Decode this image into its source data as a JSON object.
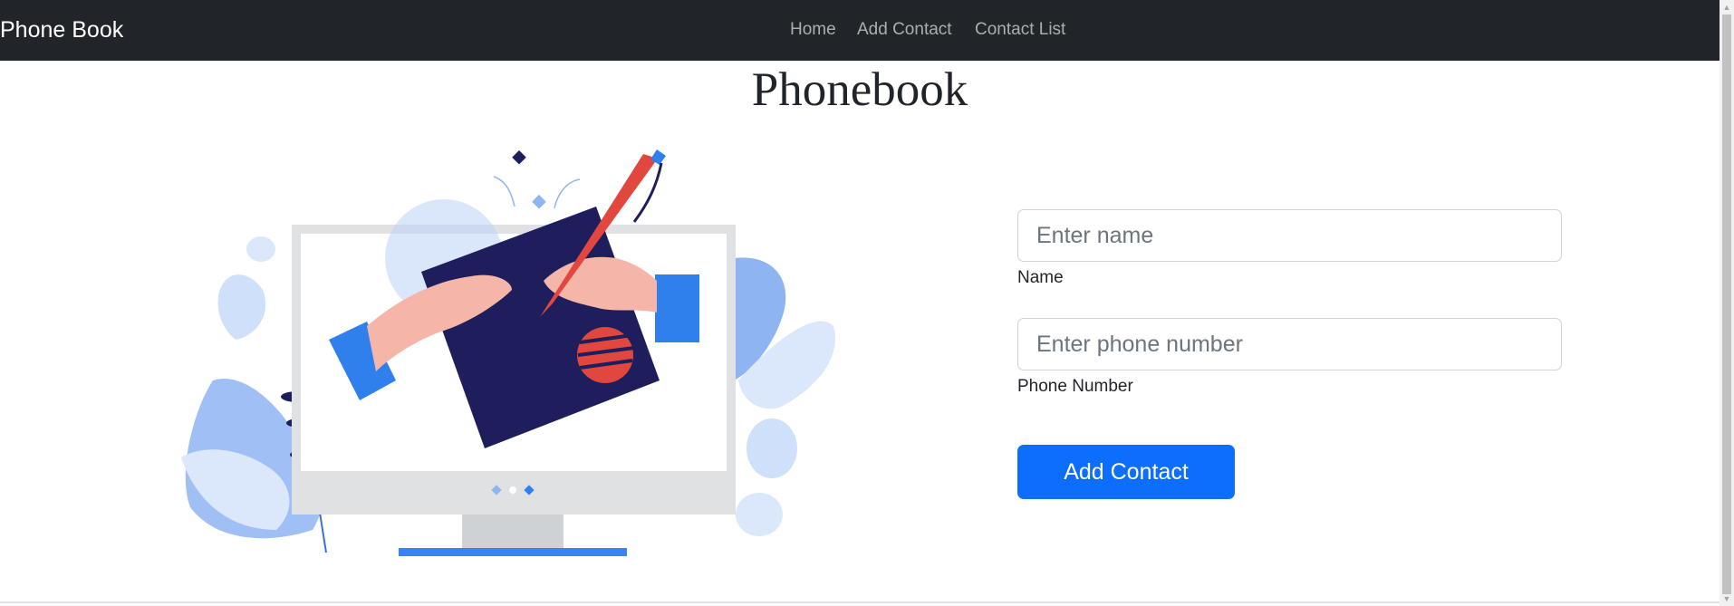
{
  "navbar": {
    "brand": "Phone Book",
    "links": [
      {
        "label": "Home"
      },
      {
        "label": "Add Contact"
      },
      {
        "label": "Contact List"
      }
    ]
  },
  "page": {
    "title": "Phonebook"
  },
  "form": {
    "name": {
      "placeholder": "Enter name",
      "value": "",
      "label": "Name"
    },
    "phone": {
      "placeholder": "Enter phone number",
      "value": "",
      "label": "Phone Number"
    },
    "submit_label": "Add Contact"
  },
  "colors": {
    "navbar_bg": "#212529",
    "primary": "#0d6efd",
    "illustration_navy": "#1e1e5c",
    "illustration_red": "#e2473f",
    "illustration_blue": "#2f80ed"
  },
  "icons": {
    "illustration": "computer-monitor-with-hands-and-pen"
  }
}
